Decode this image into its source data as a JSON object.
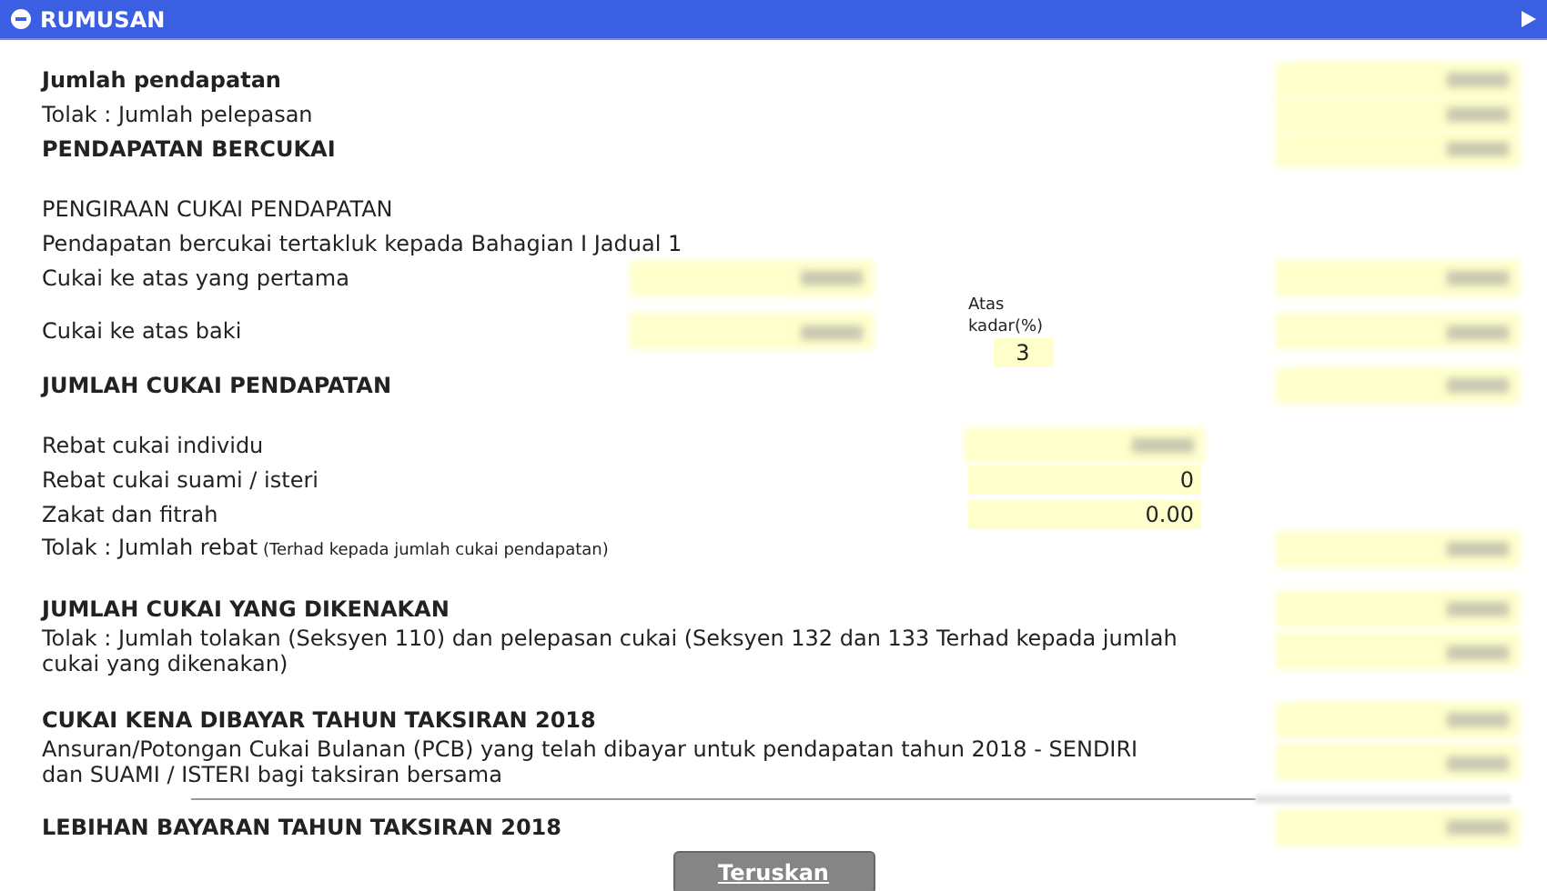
{
  "panel": {
    "title": "RUMUSAN",
    "expanded": true
  },
  "sections": [
    {
      "rows": [
        {
          "kind": "bold",
          "label": "Jumlah pendapatan",
          "total": {
            "blurred": true
          }
        },
        {
          "kind": "plain",
          "label": "Tolak : Jumlah pelepasan",
          "total": {
            "blurred": true
          }
        },
        {
          "kind": "bold",
          "label": "PENDAPATAN BERCUKAI",
          "total": {
            "blurred": true
          }
        }
      ]
    },
    {
      "rows": [
        {
          "kind": "plain",
          "label": "PENGIRAAN CUKAI PENDAPATAN"
        },
        {
          "kind": "plain",
          "label": "Pendapatan bercukai tertakluk kepada Bahagian I Jadual 1"
        },
        {
          "kind": "plain",
          "label": "Cukai ke atas yang pertama",
          "amount": {
            "blurred": true
          },
          "total": {
            "blurred": true
          }
        },
        {
          "kind": "plain",
          "label": "Cukai ke atas baki",
          "amount": {
            "blurred": true
          },
          "rate": {
            "caption": "Atas kadar(%)",
            "value": "3",
            "blurred": false
          },
          "total": {
            "blurred": true
          }
        },
        {
          "kind": "bold",
          "label": "JUMLAH CUKAI PENDAPATAN",
          "total": {
            "blurred": true
          }
        }
      ]
    },
    {
      "rows": [
        {
          "kind": "plain",
          "label": "Rebat cukai individu",
          "rebate": {
            "blurred": true
          }
        },
        {
          "kind": "plain",
          "label": "Rebat cukai suami / isteri",
          "rebate": {
            "value": "0",
            "blurred": false
          }
        },
        {
          "kind": "plain",
          "label": "Zakat dan fitrah",
          "rebate": {
            "value": "0.00",
            "blurred": false
          }
        },
        {
          "kind": "plain",
          "label": "Tolak : Jumlah rebat",
          "note": "(Terhad kepada jumlah cukai pendapatan)",
          "total": {
            "blurred": true
          }
        }
      ]
    },
    {
      "rows": [
        {
          "kind": "bold",
          "label": "JUMLAH CUKAI YANG DIKENAKAN",
          "total": {
            "blurred": true
          }
        },
        {
          "kind": "plain",
          "label": "Tolak : Jumlah tolakan (Seksyen 110) dan pelepasan cukai (Seksyen 132 dan 133 Terhad kepada jumlah cukai yang dikenakan)",
          "total": {
            "blurred": true
          }
        }
      ]
    },
    {
      "rows": [
        {
          "kind": "bold",
          "label": "CUKAI KENA DIBAYAR TAHUN TAKSIRAN 2018",
          "total": {
            "blurred": true
          }
        },
        {
          "kind": "plain",
          "label": "Ansuran/Potongan Cukai Bulanan (PCB) yang telah dibayar untuk pendapatan tahun 2018 - SENDIRI dan SUAMI / ISTERI bagi taksiran bersama",
          "total": {
            "blurred": true
          }
        },
        {
          "kind": "rule"
        },
        {
          "kind": "bold",
          "label": "LEBIHAN BAYARAN TAHUN TAKSIRAN 2018",
          "total": {
            "blurred": true
          }
        }
      ]
    }
  ],
  "button": {
    "label": "Teruskan"
  }
}
